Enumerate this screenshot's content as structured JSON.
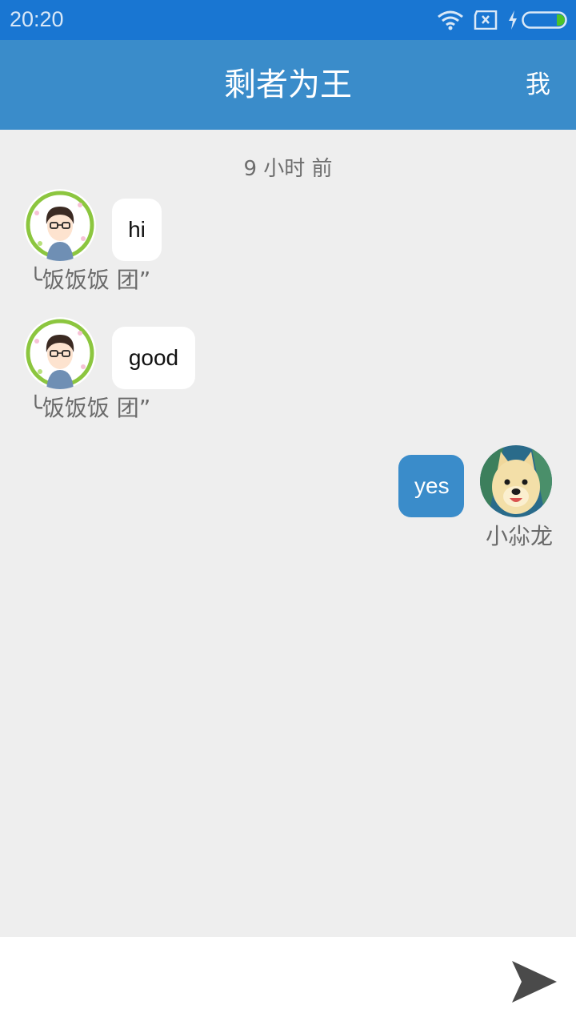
{
  "status_bar": {
    "time": "20:20",
    "icons": [
      "wifi-icon",
      "sim-x-icon",
      "charging-bolt-icon",
      "battery-icon"
    ],
    "battery_level": 0.1
  },
  "header": {
    "title": "剩者为王",
    "me_label": "我"
  },
  "chat": {
    "timestamp": "9 小时 前",
    "messages": [
      {
        "direction": "in",
        "text": "hi",
        "sender": "╰饭饭饭 团”",
        "avatar": "cartoon-boy-avatar"
      },
      {
        "direction": "in",
        "text": "good",
        "sender": "╰饭饭饭 团”",
        "avatar": "cartoon-boy-avatar"
      },
      {
        "direction": "out",
        "text": "yes",
        "sender": "小尛龙",
        "avatar": "dog-avatar"
      }
    ]
  },
  "input_bar": {
    "placeholder": "",
    "value": "",
    "send_icon": "send-icon"
  },
  "colors": {
    "status_bar": "#1976d2",
    "app_bar": "#3a8cca",
    "chat_background": "#eeeeee",
    "outgoing_bubble": "#3a8cca",
    "incoming_bubble": "#ffffff"
  }
}
